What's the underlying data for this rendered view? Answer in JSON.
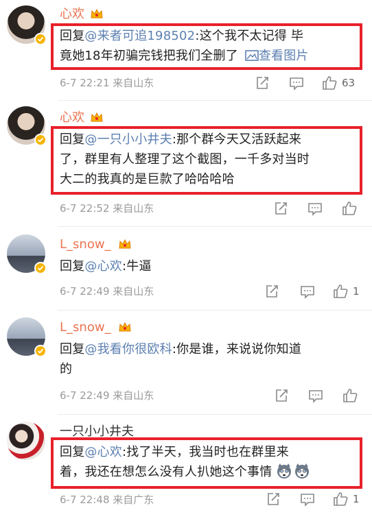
{
  "comments": [
    {
      "username": "心欢",
      "reply_prefix": "回复",
      "mention": "@来者可追198502",
      "line1_rest": ":这个我不太记得 毕",
      "line2": "竟她18年初骗完钱把我们全删了",
      "image_link": "查看图片",
      "date": "6-7 22:21",
      "source": "来自山东",
      "likes": "63"
    },
    {
      "username": "心欢",
      "reply_prefix": "回复",
      "mention": "@一只小小井夫",
      "line1_rest": ":那个群今天又活跃起来",
      "line2": "了，群里有人整理了这个截图，一千多对当时",
      "line3": "大二的我真的是巨款了哈哈哈哈",
      "date": "6-7 22:52",
      "source": "来自山东"
    },
    {
      "username": "L_snow_",
      "reply_prefix": "回复",
      "mention": "@心欢",
      "line1_rest": ":牛逼",
      "date": "6-7 22:49",
      "source": "来自山东",
      "likes": "1"
    },
    {
      "username": "L_snow_",
      "reply_prefix": "回复",
      "mention": "@我看你很欧科",
      "line1_rest": ":你是谁，来说说你知道",
      "line2": "的",
      "date": "6-7 22:49",
      "source": "来自山东"
    },
    {
      "username": "一只小小井夫",
      "reply_prefix": "回复",
      "mention": "@心欢",
      "line1_rest": ":找了半天，我当时也在群里来",
      "line2": "着，我还在想怎么没有人扒她这个事情",
      "date": "6-7 22:48",
      "source": "来自广东",
      "likes": "1"
    }
  ],
  "colors": {
    "highlight_box": "#e8202a",
    "mention": "#5b7fb0",
    "username": "#eb7350",
    "meta": "#9a9a9a"
  },
  "icons": [
    "verified-badge-icon",
    "crown-icon",
    "share-icon",
    "comment-icon",
    "like-icon",
    "image-icon",
    "husky-emoji-icon"
  ]
}
